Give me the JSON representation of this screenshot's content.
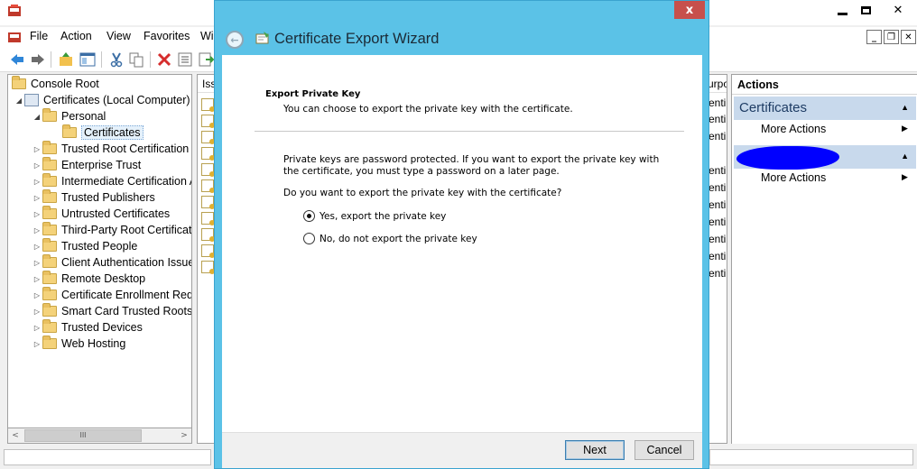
{
  "menubar": {
    "items": [
      "File",
      "Action",
      "View",
      "Favorites",
      "Wi"
    ]
  },
  "tree": {
    "items": [
      {
        "label": "Console Root",
        "arrow": ""
      },
      {
        "label": "Certificates (Local Computer)",
        "arrow": "◢"
      },
      {
        "label": "Personal",
        "arrow": "◢"
      },
      {
        "label": "Certificates",
        "arrow": ""
      },
      {
        "label": "Trusted Root Certification",
        "arrow": "▷"
      },
      {
        "label": "Enterprise Trust",
        "arrow": "▷"
      },
      {
        "label": "Intermediate Certification A",
        "arrow": "▷"
      },
      {
        "label": "Trusted Publishers",
        "arrow": "▷"
      },
      {
        "label": "Untrusted Certificates",
        "arrow": "▷"
      },
      {
        "label": "Third-Party Root Certificat",
        "arrow": "▷"
      },
      {
        "label": "Trusted People",
        "arrow": "▷"
      },
      {
        "label": "Client Authentication Issue",
        "arrow": "▷"
      },
      {
        "label": "Remote Desktop",
        "arrow": "▷"
      },
      {
        "label": "Certificate Enrollment Requ",
        "arrow": "▷"
      },
      {
        "label": "Smart Card Trusted Roots",
        "arrow": "▷"
      },
      {
        "label": "Trusted Devices",
        "arrow": "▷"
      },
      {
        "label": "Web Hosting",
        "arrow": "▷"
      }
    ],
    "scroll_thumb": "III"
  },
  "list": {
    "col_issued": "Iss",
    "col_purpose": "urpo",
    "purpose_cells": [
      "enti",
      "enti",
      "enti",
      "enti",
      "enti",
      "enti",
      "enti",
      "enti",
      "enti",
      "enti"
    ]
  },
  "actions": {
    "title": "Actions",
    "group1": "Certificates",
    "more_actions_1": "More Actions",
    "more_actions_2": "More Actions"
  },
  "wizard": {
    "title": "Certificate Export Wizard",
    "close_glyph": "x",
    "section_title": "Export Private Key",
    "section_subtitle": "You can choose to export the private key with the certificate.",
    "paragraph": "Private keys are password protected. If you want to export the private key with the certificate, you must type a password on a later page.",
    "question": "Do you want to export the private key with the certificate?",
    "option_yes": "Yes, export the private key",
    "option_no": "No, do not export the private key",
    "selected_option": "yes",
    "next_label": "Next",
    "cancel_label": "Cancel"
  },
  "colors": {
    "wizard_frame": "#5bc2e7",
    "close_button": "#c7504c",
    "action_group_header": "#c8d9ec",
    "redaction": "#0000ff"
  }
}
